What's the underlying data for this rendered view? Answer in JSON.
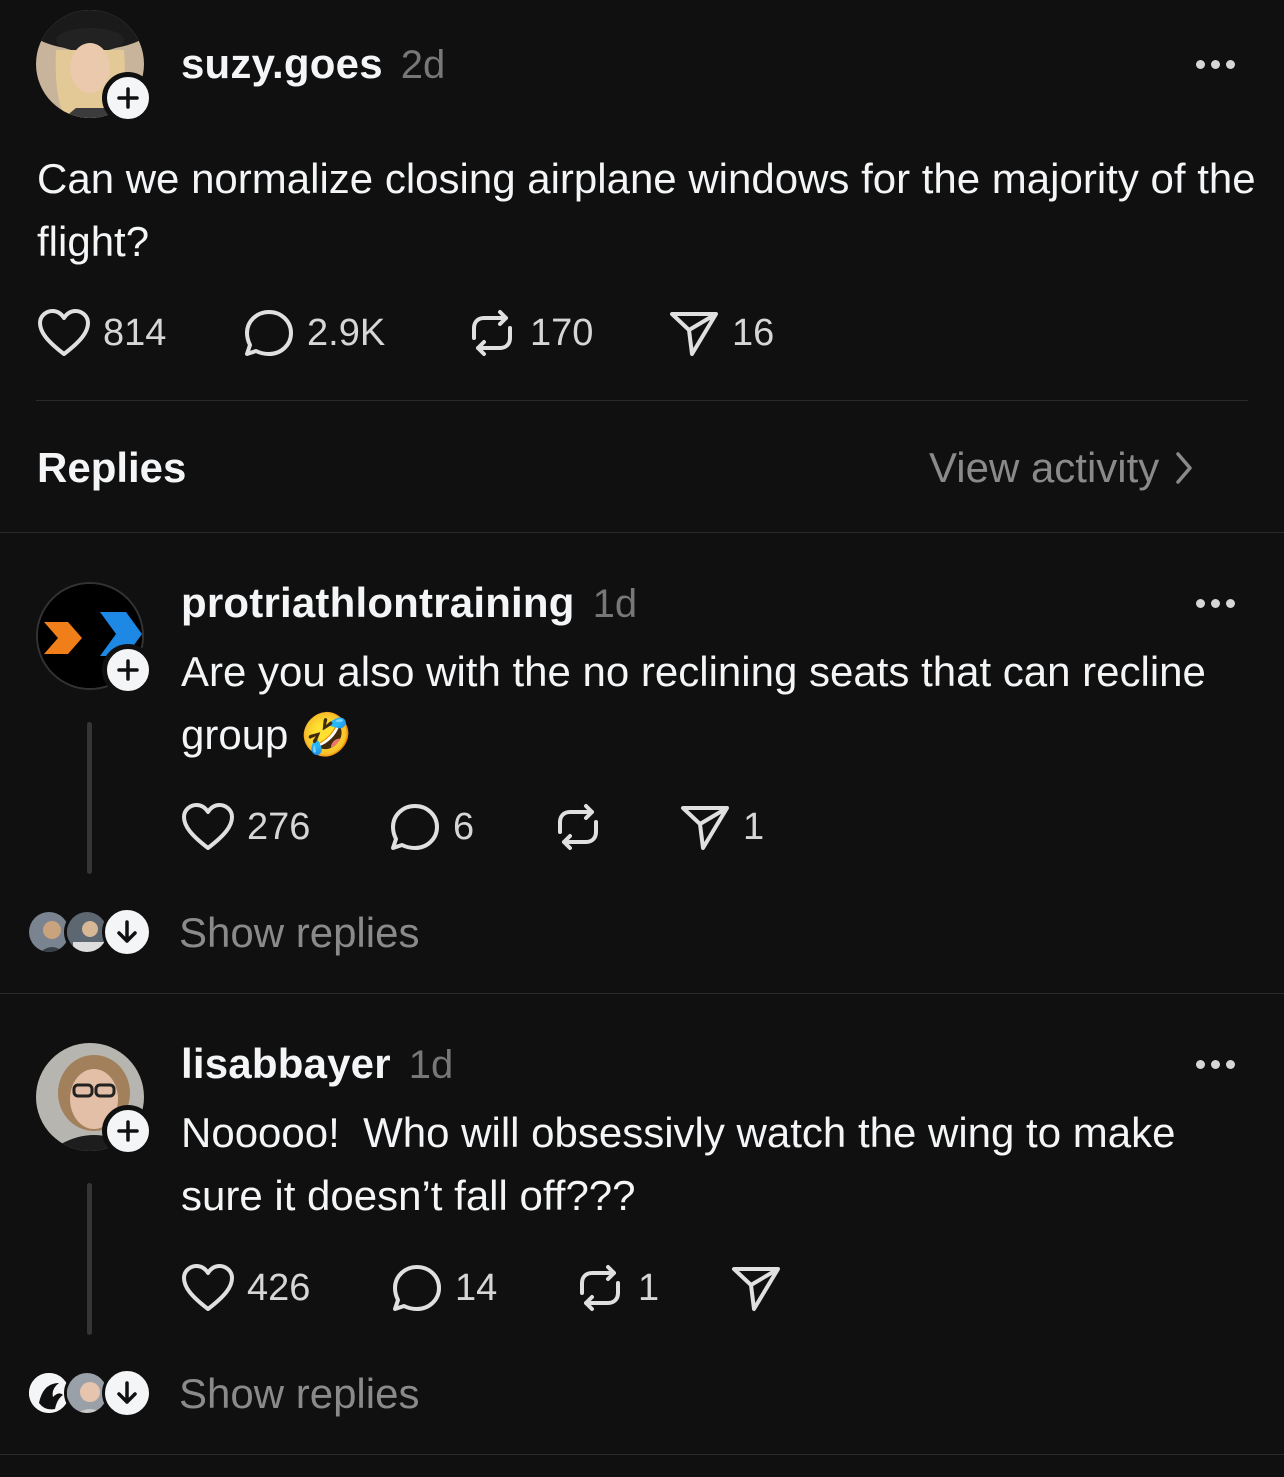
{
  "post": {
    "username": "suzy.goes",
    "time": "2d",
    "text": "Can we normalize closing airplane windows for the majority of the flight?",
    "likes": "814",
    "comments": "2.9K",
    "reposts": "170",
    "shares": "16"
  },
  "replies_header": {
    "title": "Replies",
    "view_activity": "View activity"
  },
  "replies": [
    {
      "username": "protriathlontraining",
      "time": "1d",
      "text": "Are you also with the no reclining seats that can recline group 🤣",
      "likes": "276",
      "comments": "6",
      "reposts": "",
      "shares": "1",
      "show_replies": "Show replies"
    },
    {
      "username": "lisabbayer",
      "time": "1d",
      "text": "Nooooo!  Who will obsessivly watch the wing to make sure it doesn’t fall off???",
      "likes": "426",
      "comments": "14",
      "reposts": "1",
      "shares": "",
      "show_replies": "Show replies"
    }
  ],
  "colors": {
    "background": "#101010",
    "text": "#f3f5f7",
    "muted": "#777777",
    "divider": "#2a2a2a",
    "orange_logo": "#f07f1a",
    "blue_logo": "#1e88e5"
  },
  "icons": [
    "heart-icon",
    "comment-icon",
    "repost-icon",
    "share-icon",
    "more-icon",
    "plus-icon",
    "chevron-right-icon",
    "arrow-down-icon"
  ]
}
